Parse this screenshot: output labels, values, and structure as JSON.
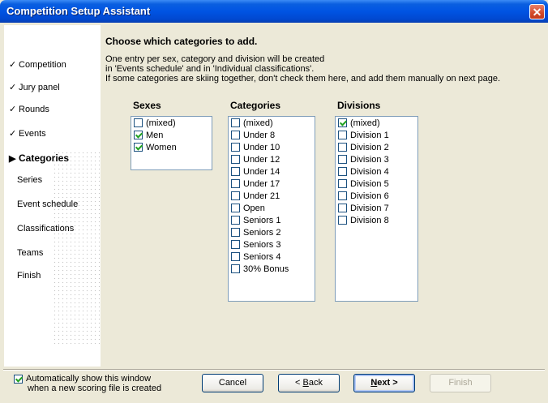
{
  "window": {
    "title": "Competition Setup Assistant",
    "close_icon": "close-icon"
  },
  "steps": [
    {
      "label": "Competition",
      "state": "done"
    },
    {
      "label": "Jury panel",
      "state": "done"
    },
    {
      "label": "Rounds",
      "state": "done"
    },
    {
      "label": "Events",
      "state": "done"
    },
    {
      "label": "Categories",
      "state": "active"
    },
    {
      "label": "Series",
      "state": "future"
    },
    {
      "label": "Event schedule",
      "state": "future"
    },
    {
      "label": "Classifications",
      "state": "future"
    },
    {
      "label": "Teams",
      "state": "future"
    },
    {
      "label": "Finish",
      "state": "future"
    }
  ],
  "check_mark": "✓",
  "arrow_mark": "▶",
  "main": {
    "heading": "Choose which categories to add.",
    "desc_lines": [
      "One entry per sex, category and division will be created",
      "in 'Events schedule' and in 'Individual classifications'.",
      "If some categories are skiing together, don't check them here, and add them manually on next page."
    ]
  },
  "lists": [
    {
      "header": "Sexes",
      "items": [
        {
          "label": "(mixed)",
          "checked": false
        },
        {
          "label": "Men",
          "checked": true
        },
        {
          "label": "Women",
          "checked": true
        }
      ]
    },
    {
      "header": "Categories",
      "items": [
        {
          "label": "(mixed)",
          "checked": false
        },
        {
          "label": "Under 8",
          "checked": false
        },
        {
          "label": "Under 10",
          "checked": false
        },
        {
          "label": "Under 12",
          "checked": false
        },
        {
          "label": "Under 14",
          "checked": false
        },
        {
          "label": "Under 17",
          "checked": false
        },
        {
          "label": "Under 21",
          "checked": false
        },
        {
          "label": "Open",
          "checked": false
        },
        {
          "label": "Seniors 1",
          "checked": false
        },
        {
          "label": "Seniors 2",
          "checked": false
        },
        {
          "label": "Seniors 3",
          "checked": false
        },
        {
          "label": "Seniors 4",
          "checked": false
        },
        {
          "label": "30% Bonus",
          "checked": false
        }
      ]
    },
    {
      "header": "Divisions",
      "items": [
        {
          "label": "(mixed)",
          "checked": true
        },
        {
          "label": "Division 1",
          "checked": false
        },
        {
          "label": "Division 2",
          "checked": false
        },
        {
          "label": "Division 3",
          "checked": false
        },
        {
          "label": "Division 4",
          "checked": false
        },
        {
          "label": "Division 5",
          "checked": false
        },
        {
          "label": "Division 6",
          "checked": false
        },
        {
          "label": "Division 7",
          "checked": false
        },
        {
          "label": "Division 8",
          "checked": false
        }
      ]
    }
  ],
  "footer": {
    "auto_show_line1": "Automatically show this window",
    "auto_show_line2": "when a new scoring file is created",
    "auto_show_checked": true,
    "cancel": "Cancel",
    "back_prefix": "< ",
    "back_mnemonic": "B",
    "back_rest": "ack",
    "next_mnemonic": "N",
    "next_rest": "ext >",
    "finish": "Finish"
  }
}
